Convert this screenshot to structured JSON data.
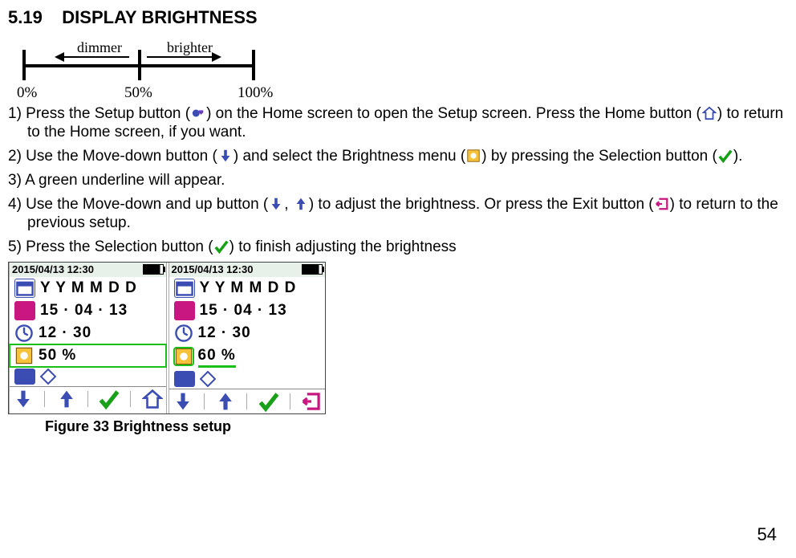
{
  "section": {
    "number": "5.19",
    "title": "DISPLAY BRIGHTNESS"
  },
  "scale": {
    "dimmer": "dimmer",
    "brighter": "brighter",
    "p0": "0%",
    "p50": "50%",
    "p100": "100%"
  },
  "steps": {
    "s1a": "1) Press the Setup button (",
    "s1b": ") on the Home screen to open the Setup screen. Press the Home button (",
    "s1c": ") to return to the Home screen, if you want.",
    "s2a": "2) Use the Move-down button (",
    "s2b": ") and select the Brightness menu (",
    "s2c": ") by pressing the Selection button (",
    "s2d": ").",
    "s3": "3) A green underline will appear.",
    "s4a": "4) Use the Move-down and up button (",
    "s4comma": ", ",
    "s4b": ") to adjust the brightness. Or press the Exit button (",
    "s4c": ") to return to the previous setup.",
    "s5a": "5) Press the Selection button (",
    "s5b": ") to finish adjusting the brightness"
  },
  "screens": {
    "datetime": "2015/04/13 12:30",
    "ymd_label": "Y Y  M M  D D",
    "date_value": "15 · 04 · 13",
    "time_value": "12 · 30",
    "brightness_left": "50 %",
    "brightness_right": "60 %"
  },
  "figure_caption": "Figure 33 Brightness setup",
  "page_number": "54"
}
